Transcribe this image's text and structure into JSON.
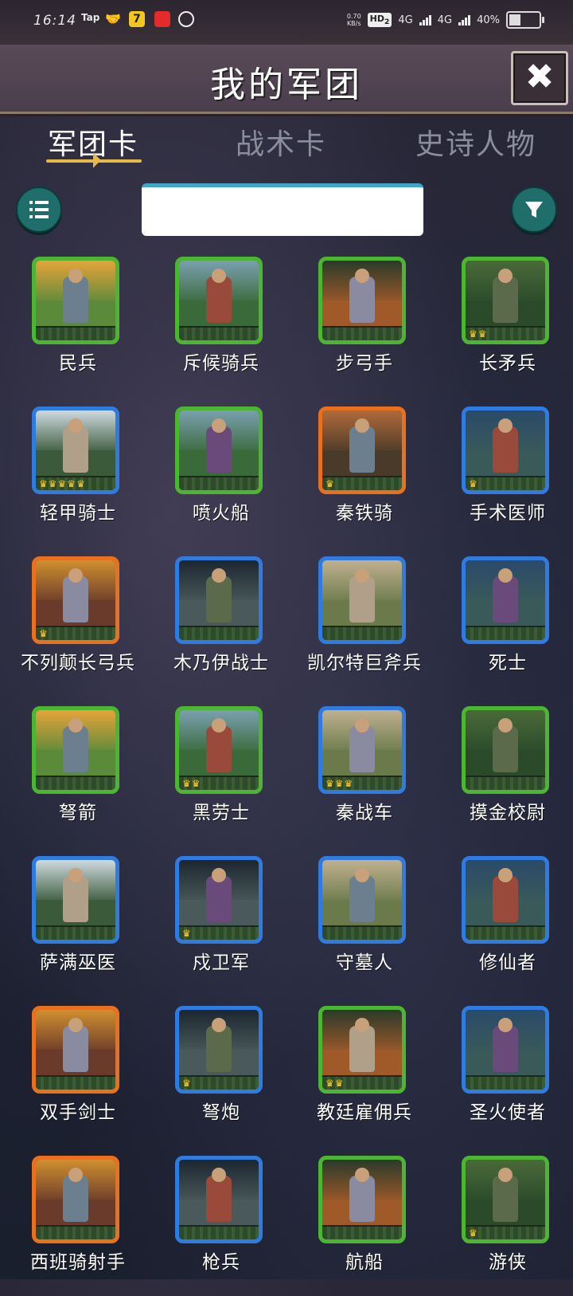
{
  "status_bar": {
    "time": "16:14",
    "app_icons": [
      "Tap",
      "handshake-icon",
      "7-icon",
      "red-app-icon",
      "cloud-icon"
    ],
    "net_speed_value": "0.70",
    "net_speed_unit": "KB/s",
    "hd": "HD",
    "hd_sub": "2",
    "network1": "4G",
    "network2": "4G",
    "battery": "40%",
    "battery_level": 0.4
  },
  "header": {
    "title": "我的军团",
    "close_icon": "close-icon"
  },
  "tabs": [
    {
      "label": "军团卡",
      "active": true
    },
    {
      "label": "战术卡",
      "active": false
    },
    {
      "label": "史诗人物",
      "active": false
    }
  ],
  "toolbar": {
    "list_icon": "list-icon",
    "filter_icon": "filter-icon",
    "search_value": "",
    "search_placeholder": ""
  },
  "colors": {
    "green": "#4cb632",
    "blue": "#2f7be0",
    "orange": "#e8701e",
    "tab_active": "#ffffff",
    "tab_inactive": "#8a8e9a",
    "accent_gold": "#e8b84a",
    "button_teal": "#1f6e6c"
  },
  "cards": [
    {
      "name": "民兵",
      "rarity": "green",
      "crowns": 0
    },
    {
      "name": "斥候骑兵",
      "rarity": "green",
      "crowns": 0
    },
    {
      "name": "步弓手",
      "rarity": "green",
      "crowns": 0
    },
    {
      "name": "长矛兵",
      "rarity": "green",
      "crowns": 2
    },
    {
      "name": "轻甲骑士",
      "rarity": "blue",
      "crowns": 5
    },
    {
      "name": "喷火船",
      "rarity": "green",
      "crowns": 0
    },
    {
      "name": "秦铁骑",
      "rarity": "orange",
      "crowns": 1
    },
    {
      "name": "手术医师",
      "rarity": "blue",
      "crowns": 1
    },
    {
      "name": "不列颠长弓兵",
      "rarity": "orange",
      "crowns": 1
    },
    {
      "name": "木乃伊战士",
      "rarity": "blue",
      "crowns": 0
    },
    {
      "name": "凯尔特巨斧兵",
      "rarity": "blue",
      "crowns": 0
    },
    {
      "name": "死士",
      "rarity": "blue",
      "crowns": 0
    },
    {
      "name": "弩箭",
      "rarity": "green",
      "crowns": 0
    },
    {
      "name": "黑劳士",
      "rarity": "green",
      "crowns": 2
    },
    {
      "name": "秦战车",
      "rarity": "blue",
      "crowns": 3
    },
    {
      "name": "摸金校尉",
      "rarity": "green",
      "crowns": 0
    },
    {
      "name": "萨满巫医",
      "rarity": "blue",
      "crowns": 0
    },
    {
      "name": "戍卫军",
      "rarity": "blue",
      "crowns": 1
    },
    {
      "name": "守墓人",
      "rarity": "blue",
      "crowns": 0
    },
    {
      "name": "修仙者",
      "rarity": "blue",
      "crowns": 0
    },
    {
      "name": "双手剑士",
      "rarity": "orange",
      "crowns": 0
    },
    {
      "name": "弩炮",
      "rarity": "blue",
      "crowns": 1
    },
    {
      "name": "教廷雇佣兵",
      "rarity": "green",
      "crowns": 2
    },
    {
      "name": "圣火使者",
      "rarity": "blue",
      "crowns": 0
    },
    {
      "name": "西班骑射手",
      "rarity": "orange",
      "crowns": 0
    },
    {
      "name": "枪兵",
      "rarity": "blue",
      "crowns": 0
    },
    {
      "name": "航船",
      "rarity": "green",
      "crowns": 0
    },
    {
      "name": "游侠",
      "rarity": "green",
      "crowns": 1
    }
  ]
}
